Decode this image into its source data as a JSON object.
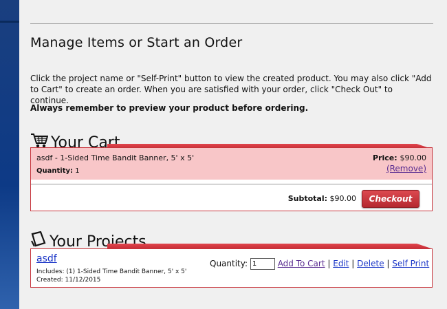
{
  "page": {
    "title": "Manage Items or Start an Order",
    "intro": "Click the project name or \"Self-Print\" button to view the created product. You may also click \"Add to Cart\" to create an order. When you are satisfied with your order, click \"Check Out\" to continue.",
    "remember": "Always remember to preview your product before ordering."
  },
  "cart": {
    "heading": "Your Cart",
    "icon": "cart-icon",
    "item_name": "asdf - 1-Sided Time Bandit Banner, 5' x 5'",
    "quantity_label": "Quantity:",
    "quantity_value": "1",
    "price_label": "Price:",
    "price_value": "$90.00",
    "remove_label": "(Remove)",
    "subtotal_label": "Subtotal:",
    "subtotal_value": "$90.00",
    "checkout_label": "Checkout"
  },
  "projects": {
    "heading": "Your Projects",
    "icon": "page-icon",
    "items": [
      {
        "name": "asdf",
        "includes": "Includes: (1) 1-Sided Time Bandit Banner, 5' x 5'",
        "created": "Created: 11/12/2015",
        "quantity_label": "Quantity:",
        "quantity_value": "1",
        "add_to_cart": "Add To Cart",
        "edit": "Edit",
        "delete": "Delete",
        "self_print": "Self Print"
      }
    ]
  },
  "colors": {
    "accent_red": "#c7333b",
    "cart_row": "#f8c6c8",
    "link_blue": "#1a35c7",
    "visited_purple": "#5a2d91",
    "sidebar_blue": "#0d3a86"
  }
}
